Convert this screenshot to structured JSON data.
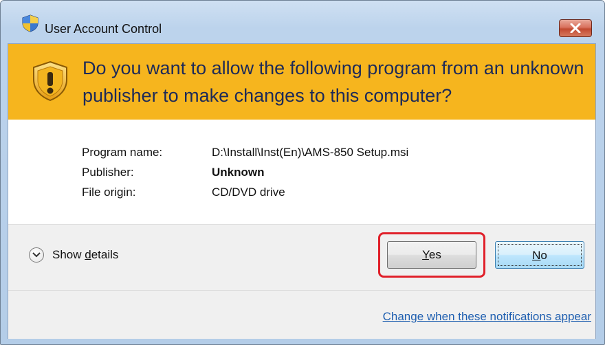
{
  "window": {
    "title": "User Account Control",
    "close_label": "Close"
  },
  "banner": {
    "question": "Do you want to allow the following program from an unknown publisher to make changes to this computer?"
  },
  "info": {
    "rows": [
      {
        "label": "Program name:",
        "value": "D:\\Install\\Inst(En)\\AMS-850 Setup.msi"
      },
      {
        "label": "Publisher:",
        "value": "Unknown"
      },
      {
        "label": "File origin:",
        "value": "CD/DVD drive"
      }
    ]
  },
  "details": {
    "pre": "Show ",
    "accel": "d",
    "post": "etails"
  },
  "buttons": {
    "yes": {
      "accel": "Y",
      "rest": "es"
    },
    "no": {
      "accel": "N",
      "rest": "o"
    }
  },
  "link": {
    "text": "Change when these notifications appear"
  },
  "colors": {
    "banner": "#f6b51e",
    "highlight": "#e0202a",
    "link": "#1f5fb0"
  },
  "icons": {
    "title": "uac-shield-icon",
    "banner": "warning-shield-icon",
    "close": "close-icon",
    "details": "chevron-down-icon"
  }
}
